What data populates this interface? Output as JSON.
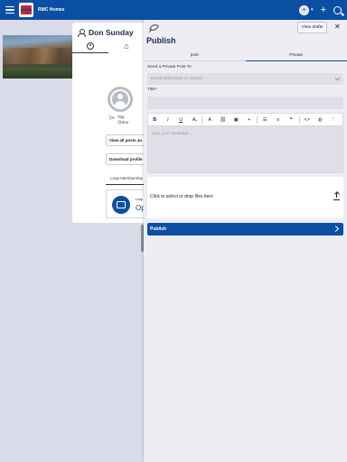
{
  "topbar": {
    "app_name": "RMC Homes",
    "add_icon": "plus-icon",
    "search_icon": "search-icon",
    "brand_color": "#0b4fa3"
  },
  "profile": {
    "name": "Don Sunday",
    "tabs": [
      "profile-icon",
      "home-icon"
    ],
    "tag_label": "Tag",
    "handle": "@don",
    "view_all_posts": "View all posts an",
    "download_profile": "Download profile",
    "leap_tab": "Leap Membership",
    "leap_small": "Leap",
    "leap_big": "Op"
  },
  "publish": {
    "title": "Publish",
    "view_drafts": "View drafts",
    "close": "✕",
    "tabs": [
      {
        "label": "post",
        "active": false
      },
      {
        "label": "Private",
        "active": true
      }
    ],
    "post_to_label": "Send a Private Post To",
    "recipients_placeholder": "Email addresses or names",
    "title_label": "Title*",
    "title_value": "",
    "toolbar": {
      "bold": "B",
      "italic": "I",
      "underline": "U",
      "strike": "A̶",
      "font_size": "A",
      "link": "⛓",
      "image": "▣",
      "more": "+",
      "bullet_list": "☰",
      "numbered_list": "≡",
      "quote": "❝",
      "code": "<>",
      "globe": "◍",
      "menu": "⋮"
    },
    "editor_placeholder": "type your message...",
    "dropzone_text": "Click to select or drop files here",
    "publish_button": "Publish"
  }
}
